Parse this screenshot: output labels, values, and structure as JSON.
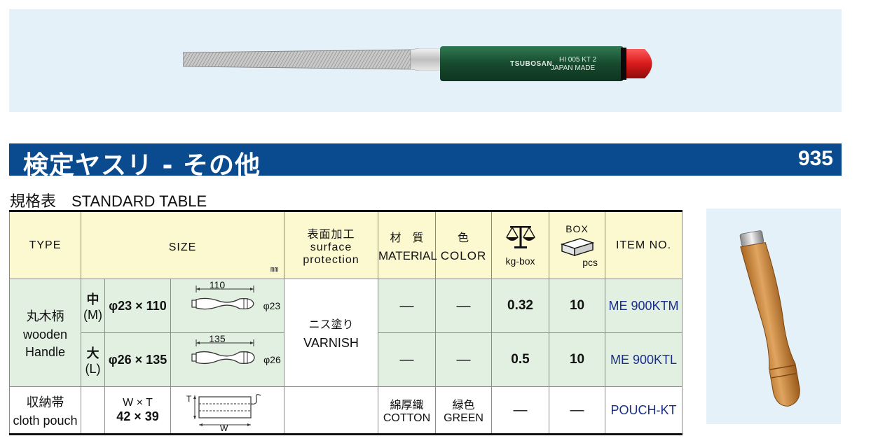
{
  "banner": {
    "file_brand": "TSUBOSAN",
    "file_code": "HI 005 KT 2",
    "file_origin": "JAPAN MADE"
  },
  "title": "検定ヤスリ - その他",
  "page_number": "935",
  "subtitle": "規格表　STANDARD TABLE",
  "table": {
    "headers": {
      "type": "TYPE",
      "size": "SIZE",
      "size_unit": "㎜",
      "surface_jp": "表面加工",
      "surface_en1": "surface",
      "surface_en2": "protection",
      "material_jp": "材　質",
      "material_en": "MATERIAL",
      "color_jp": "色",
      "color_en": "COLOR",
      "weight_unit": "kg-box",
      "box": "BOX",
      "box_unit": "pcs",
      "item": "ITEM NO."
    },
    "handle": {
      "type_jp": "丸木柄",
      "type_en1": "wooden",
      "type_en2": "Handle",
      "surface_jp": "ニス塗り",
      "surface_en": "VARNISH"
    },
    "rows": [
      {
        "size_jp": "中",
        "size_code": "(M)",
        "dims": "φ23 × 110",
        "diagram_length": "110",
        "diagram_dia": "φ23",
        "material": "—",
        "color": "—",
        "weight": "0.32",
        "box": "10",
        "item": "ME 900KTM"
      },
      {
        "size_jp": "大",
        "size_code": "(L)",
        "dims": "φ26 × 135",
        "diagram_length": "135",
        "diagram_dia": "φ26",
        "material": "—",
        "color": "—",
        "weight": "0.5",
        "box": "10",
        "item": "ME 900KTL"
      }
    ],
    "pouch": {
      "type_jp": "収納帯",
      "type_en": "cloth pouch",
      "dims_label": "W × T",
      "dims": "42 × 39",
      "diagram_t": "T",
      "diagram_w": "W",
      "material_jp": "綿厚織",
      "material_en": "COTTON",
      "color_jp": "緑色",
      "color_en": "GREEN",
      "weight": "—",
      "box": "—",
      "item": "POUCH-KT"
    }
  },
  "colors": {
    "title_bar": "#0a4a8e",
    "banner_bg": "#e4f1f9",
    "header_bg": "#fcf8d0",
    "row_bg": "#e2f0e2",
    "item_text": "#1a2d8a",
    "handle_green": "#1f5a3a",
    "cap_red": "#d81a1a",
    "wood": "#d18a3a"
  }
}
